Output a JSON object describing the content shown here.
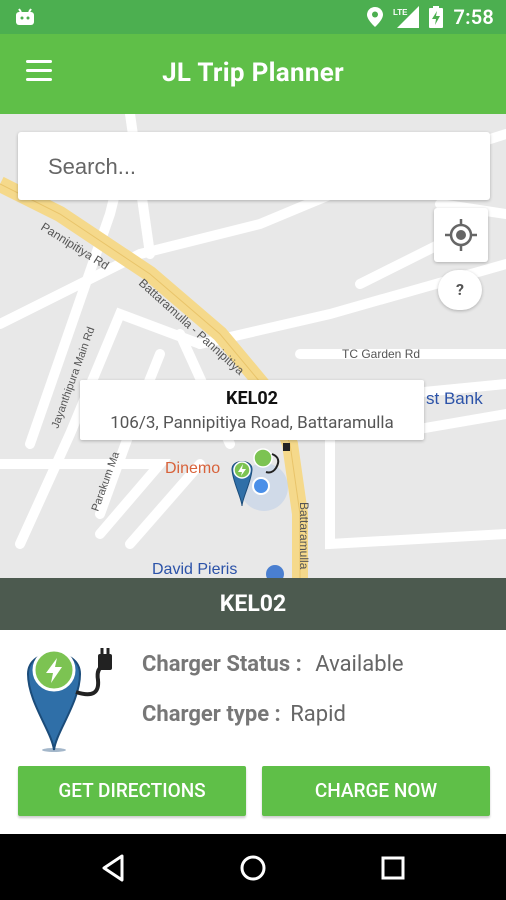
{
  "status_bar": {
    "time": "7:58",
    "network_label": "LTE"
  },
  "app_bar": {
    "title": "JL Trip Planner"
  },
  "search": {
    "placeholder": "Search...",
    "value": ""
  },
  "map": {
    "help_label": "?",
    "info_window": {
      "title": "KEL02",
      "address": "106/3, Pannipitiya Road, Battaramulla"
    },
    "labels": {
      "pannipitiya_rd": "Pannipitiya Rd",
      "battaramulla_pannipitiya": "Battaramulla - Pannipitiya",
      "jayanthipura_main_rd": "Jayanthipura Main Rd",
      "tc_garden_rd": "TC Garden Rd",
      "bank": "st Bank",
      "parakum": "Parakum Ma",
      "dinemo": "Dinemo",
      "david_pieris": "David Pieris",
      "battaramulla_vertical": "Battaramulla"
    }
  },
  "station": {
    "name": "KEL02",
    "charger_status_label": "Charger Status :",
    "charger_status_value": "Available",
    "charger_type_label": "Charger type :",
    "charger_type_value": "Rapid"
  },
  "actions": {
    "directions_label": "GET DIRECTIONS",
    "charge_label": "CHARGE NOW"
  },
  "colors": {
    "primary": "#5fbf48",
    "status_bar": "#4caf50",
    "station_bar": "#4c5a4f",
    "map_bg": "#e8e8e8",
    "road_major": "#f5d98b"
  }
}
